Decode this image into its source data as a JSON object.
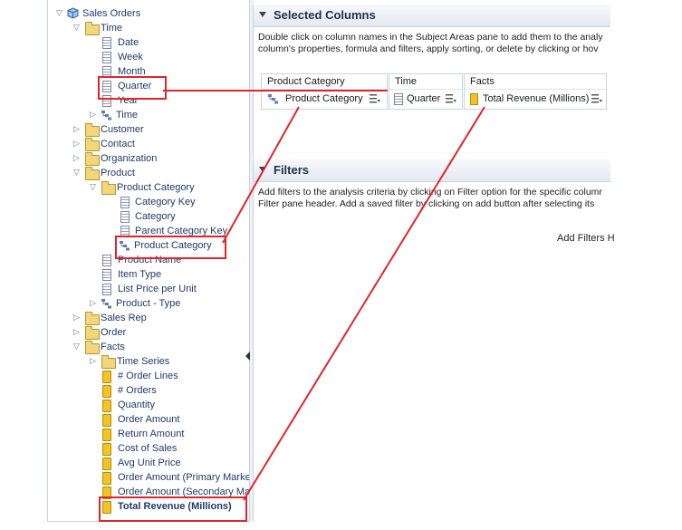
{
  "tree": {
    "root": "Sales Orders",
    "time": "Time",
    "time_children": [
      "Date",
      "Week",
      "Month",
      "Quarter",
      "Year"
    ],
    "time_hier": "Time",
    "customer": "Customer",
    "contact": "Contact",
    "organization": "Organization",
    "product": "Product",
    "product_category": "Product Category",
    "pc_children": [
      "Category Key",
      "Category",
      "Parent Category Key"
    ],
    "pc_hier": "Product Category",
    "product_children": [
      "Product Name",
      "Item Type",
      "List Price per Unit"
    ],
    "product_type": "Product - Type",
    "sales_rep": "Sales Rep",
    "order": "Order",
    "facts": "Facts",
    "time_series": "Time Series",
    "fact_children": [
      "# Order Lines",
      "# Orders",
      "Quantity",
      "Order Amount",
      "Return Amount",
      "Cost of Sales",
      "Avg Unit Price",
      "Order Amount (Primary Marke",
      "Order Amount (Secondary Ma"
    ],
    "total_revenue": "Total Revenue (Millions)"
  },
  "selected_columns": {
    "title": "Selected Columns",
    "help_line1": "Double click on column names in the Subject Areas pane to add them to the analy",
    "help_line2": "column's properties, formula and filters, apply sorting, or delete by clicking or hov",
    "columns": [
      {
        "folder": "Product Category",
        "item": "Product Category",
        "icon": "hierarchy-icon"
      },
      {
        "folder": "Time",
        "item": "Quarter",
        "icon": "column-icon"
      },
      {
        "folder": "Facts",
        "item": "Total Revenue (Millions)",
        "icon": "measure-icon"
      }
    ]
  },
  "filters": {
    "title": "Filters",
    "help_line1": "Add filters to the analysis criteria by clicking on Filter option for the specific columr",
    "help_line2": "Filter pane header. Add a saved filter by clicking on add button after selecting its",
    "add_filters": "Add Filters H"
  },
  "colors": {
    "annotation_red": "#e0252b",
    "text_blue": "#1f3a6a",
    "folder_yellow": "#f1d67a",
    "measure_yellow": "#f3c321"
  }
}
